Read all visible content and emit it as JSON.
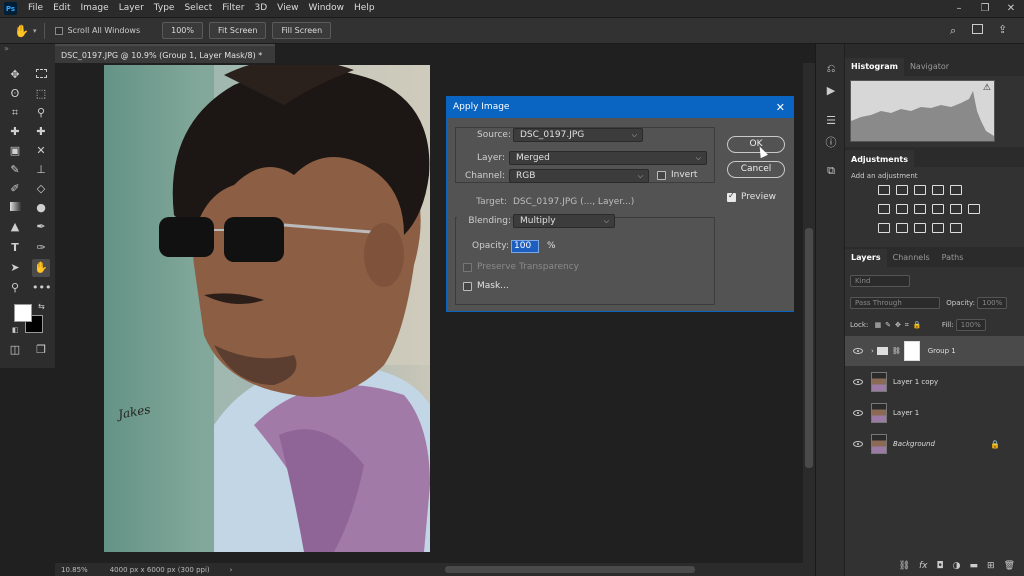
{
  "menubar": {
    "logo": "Ps",
    "items": [
      "File",
      "Edit",
      "Image",
      "Layer",
      "Type",
      "Select",
      "Filter",
      "3D",
      "View",
      "Window",
      "Help"
    ],
    "window_controls": [
      "–",
      "❐",
      "✕"
    ]
  },
  "options_bar": {
    "scroll_all_windows": "Scroll All Windows",
    "zoom_value": "100%",
    "fit_screen": "Fit Screen",
    "fill_screen": "Fill Screen"
  },
  "document": {
    "tab_title": "DSC_0197.JPG @ 10.9% (Group 1, Layer Mask/8) *",
    "close": "×",
    "watermark_text": "Jakes"
  },
  "status": {
    "zoom": "10.85%",
    "size": "4000 px x 6000 px (300 ppi)",
    "arrow": "›"
  },
  "panels": {
    "histogram_tab": "Histogram",
    "navigator_tab": "Navigator",
    "adjustments_tab": "Adjustments",
    "add_adjustment": "Add an adjustment",
    "layers_tab": "Layers",
    "channels_tab": "Channels",
    "paths_tab": "Paths",
    "kind_placeholder": "Kind",
    "blend_mode": "Pass Through",
    "opacity_label": "Opacity:",
    "opacity_value": "100%",
    "lock_label": "Lock:",
    "fill_label": "Fill:",
    "fill_value": "100%",
    "layers": [
      {
        "name": "Group 1"
      },
      {
        "name": "Layer 1 copy"
      },
      {
        "name": "Layer 1"
      },
      {
        "name": "Background"
      }
    ]
  },
  "dialog": {
    "title": "Apply Image",
    "close": "✕",
    "source_label": "Source:",
    "source_value": "DSC_0197.JPG",
    "layer_label": "Layer:",
    "layer_value": "Merged",
    "channel_label": "Channel:",
    "channel_value": "RGB",
    "invert_label": "Invert",
    "target_label": "Target:",
    "target_value": "DSC_0197.JPG (..., Layer...)",
    "blending_label": "Blending:",
    "blending_value": "Multiply",
    "opacity_label": "Opacity:",
    "opacity_value": "100",
    "opacity_unit": "%",
    "preserve_transparency": "Preserve Transparency",
    "mask_label": "Mask...",
    "ok": "OK",
    "cancel": "Cancel",
    "preview_label": "Preview",
    "preview_checked": true,
    "invert_checked": false
  },
  "colors": {
    "accent": "#0a64c2",
    "ui_dark": "#2b2b2b",
    "dialog_bg": "#535353"
  }
}
